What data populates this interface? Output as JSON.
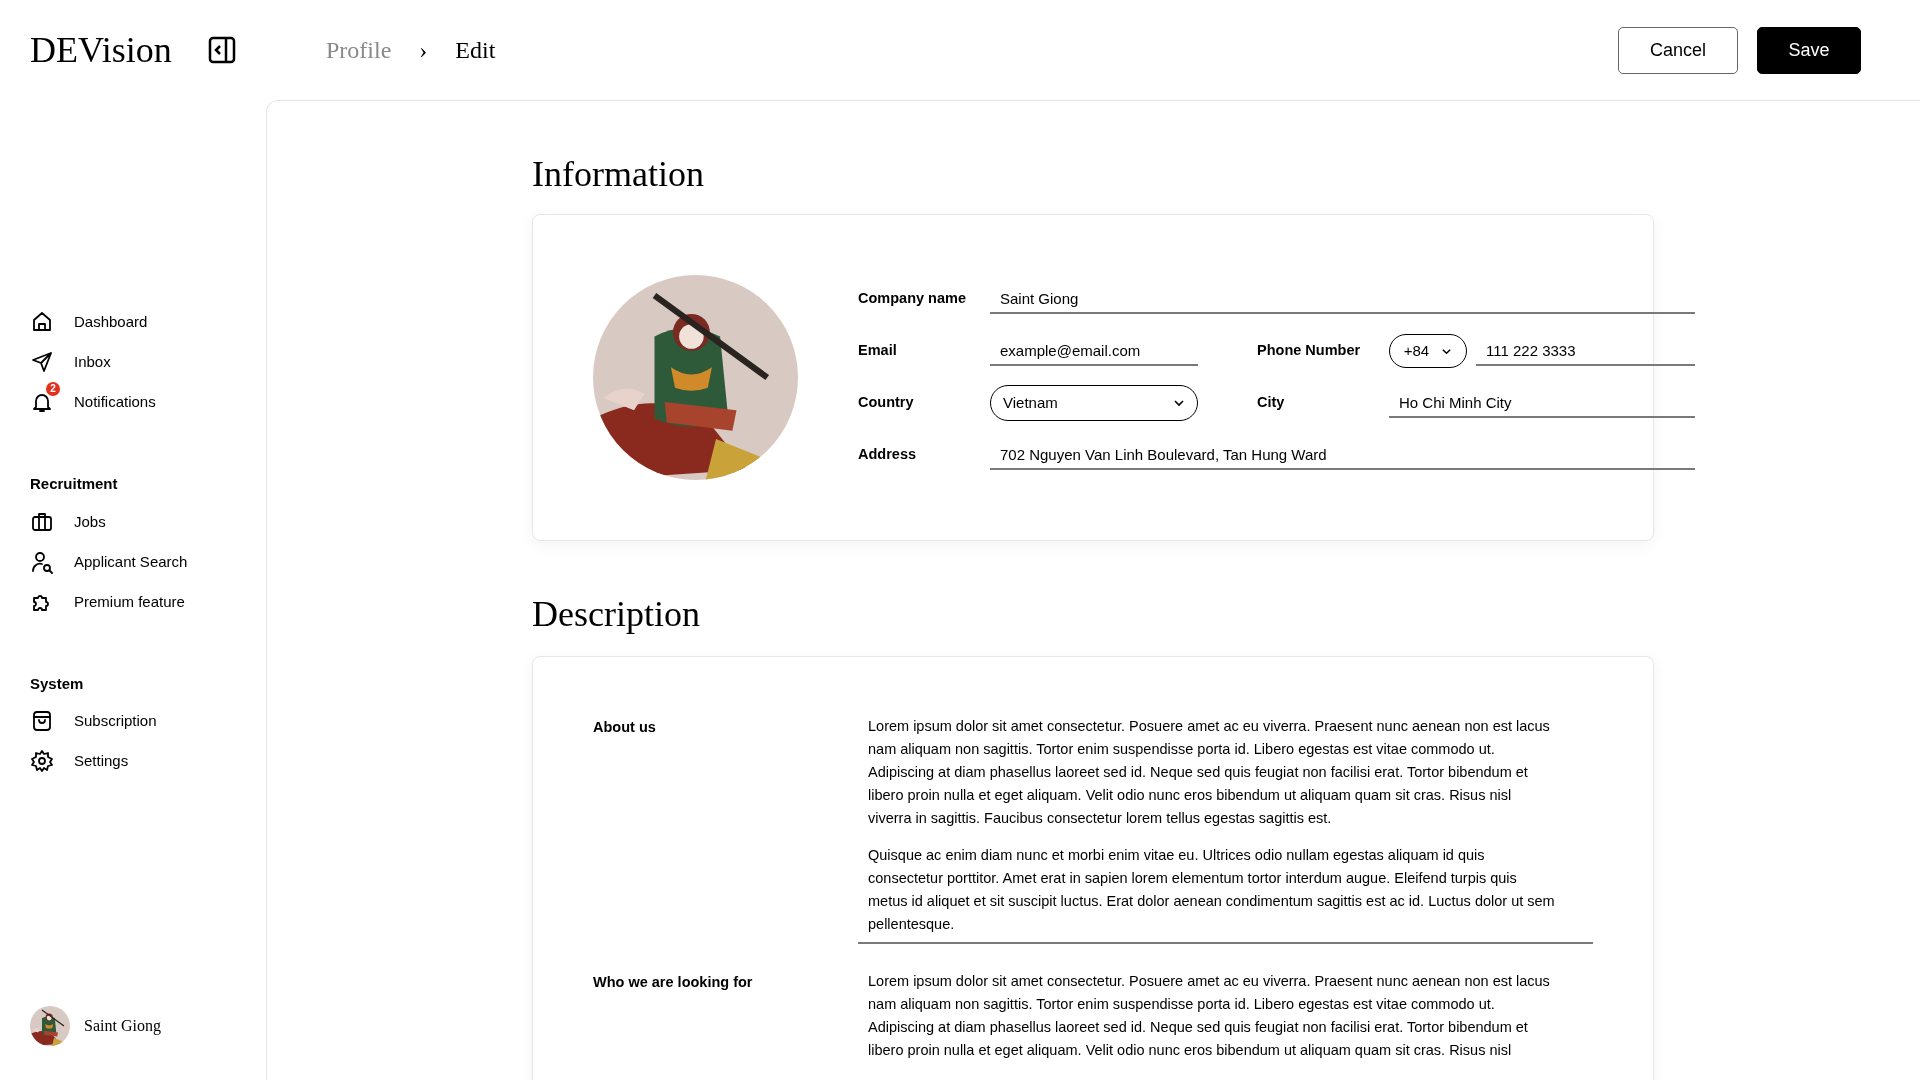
{
  "header": {
    "logo": "DEVision",
    "breadcrumb": [
      "Profile",
      "Edit"
    ],
    "breadcrumb_separator": "›",
    "buttons": [
      {
        "label": "Cancel",
        "kind": "secondary"
      },
      {
        "label": "Save",
        "kind": "primary"
      }
    ]
  },
  "sidebar": {
    "sections": [
      {
        "items": [
          {
            "label": "Dashboard"
          },
          {
            "label": "Inbox"
          },
          {
            "label": "Notifications",
            "badge": "2"
          }
        ]
      },
      {
        "title": "Recruitment",
        "items": [
          {
            "label": "Jobs"
          },
          {
            "label": "Applicant Search"
          },
          {
            "label": "Premium feature"
          }
        ]
      },
      {
        "title": "System",
        "items": [
          {
            "label": "Subscription"
          },
          {
            "label": "Settings"
          }
        ]
      }
    ],
    "user": {
      "name": "Saint Giong"
    }
  },
  "information": {
    "title": "Information",
    "fields": [
      {
        "label": "Company name",
        "value": "Saint Giong",
        "kind": "text"
      },
      {
        "label": "Email",
        "value": "example@email.com",
        "kind": "text"
      },
      {
        "label": "Phone Number",
        "code": "+84",
        "value": "111 222 3333",
        "kind": "phone"
      },
      {
        "label": "Country",
        "value": "Vietnam",
        "kind": "select"
      },
      {
        "label": "City",
        "value": "Ho Chi Minh City",
        "kind": "text"
      },
      {
        "label": "Address",
        "value": "702 Nguyen Van Linh Boulevard, Tan Hung Ward",
        "kind": "text"
      }
    ]
  },
  "description": {
    "title": "Description",
    "sections": [
      {
        "label": "About us",
        "paragraphs": [
          {
            "lines": [
              "Lorem ipsum dolor sit amet consectetur. Posuere amet ac eu viverra. Praesent nunc aenean non est lacus",
              "nam aliquam non sagittis. Tortor enim suspendisse porta id. Libero egestas est vitae commodo ut.",
              "Adipiscing at diam phasellus laoreet sed id. Neque sed quis feugiat non facilisi erat. Tortor bibendum et",
              "libero proin nulla et eget aliquam. Velit odio nunc eros bibendum ut aliquam quam sit cras. Risus nisl",
              "viverra in sagittis. Faucibus consectetur lorem tellus egestas sagittis est."
            ]
          },
          {
            "lines": [
              "Quisque ac enim diam nunc et morbi enim vitae eu. Ultrices odio nullam egestas aliquam id quis",
              "consectetur porttitor. Amet erat in sapien lorem elementum tortor interdum augue. Eleifend turpis quis",
              "metus id aliquet et sit suscipit luctus. Erat dolor aenean condimentum sagittis est ac id. Luctus dolor ut sem",
              "pellentesque."
            ]
          }
        ]
      },
      {
        "label": "Who we are looking for",
        "paragraphs": [
          {
            "lines": [
              "Lorem ipsum dolor sit amet consectetur. Posuere amet ac eu viverra. Praesent nunc aenean non est lacus",
              "nam aliquam non sagittis. Tortor enim suspendisse porta id. Libero egestas est vitae commodo ut.",
              "Adipiscing at diam phasellus laoreet sed id. Neque sed quis feugiat non facilisi erat. Tortor bibendum et",
              "libero proin nulla et eget aliquam. Velit odio nunc eros bibendum ut aliquam quam sit cras. Risus nisl"
            ]
          }
        ]
      }
    ]
  }
}
